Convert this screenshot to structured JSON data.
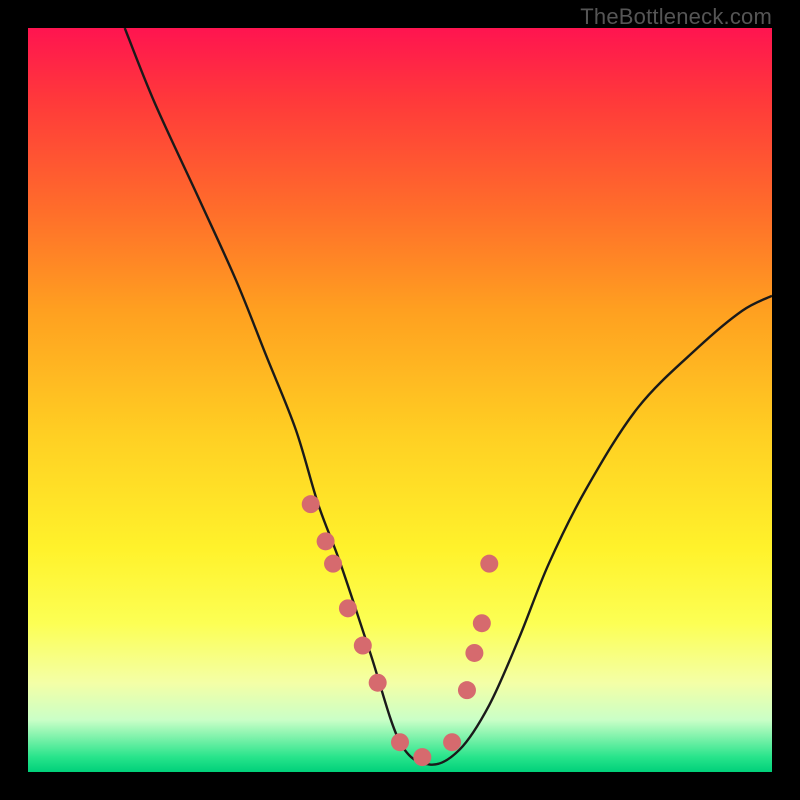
{
  "watermark": "TheBottleneck.com",
  "chart_data": {
    "type": "line",
    "title": "",
    "xlabel": "",
    "ylabel": "",
    "xlim": [
      0,
      100
    ],
    "ylim": [
      0,
      100
    ],
    "series": [
      {
        "name": "curve",
        "x": [
          13,
          17,
          23,
          28,
          32,
          36,
          39,
          42,
          46,
          50,
          54,
          58,
          62,
          66,
          70,
          75,
          82,
          90,
          96,
          100
        ],
        "values": [
          100,
          90,
          77,
          66,
          56,
          46,
          36,
          28,
          16,
          4,
          1,
          3,
          9,
          18,
          28,
          38,
          49,
          57,
          62,
          64
        ]
      }
    ],
    "scatter": [
      {
        "name": "dots",
        "x": [
          38,
          40,
          41,
          43,
          45,
          47,
          50,
          53,
          57,
          59,
          60,
          61,
          62
        ],
        "y": [
          36,
          31,
          28,
          22,
          17,
          12,
          4,
          2,
          4,
          11,
          16,
          20,
          28
        ],
        "color": "#d66a6e",
        "size": 9
      }
    ],
    "colors": {
      "curve": "#1a1a1a",
      "dots": "#d66a6e",
      "gradient_top": "#ff1450",
      "gradient_bottom": "#00d07a"
    }
  }
}
